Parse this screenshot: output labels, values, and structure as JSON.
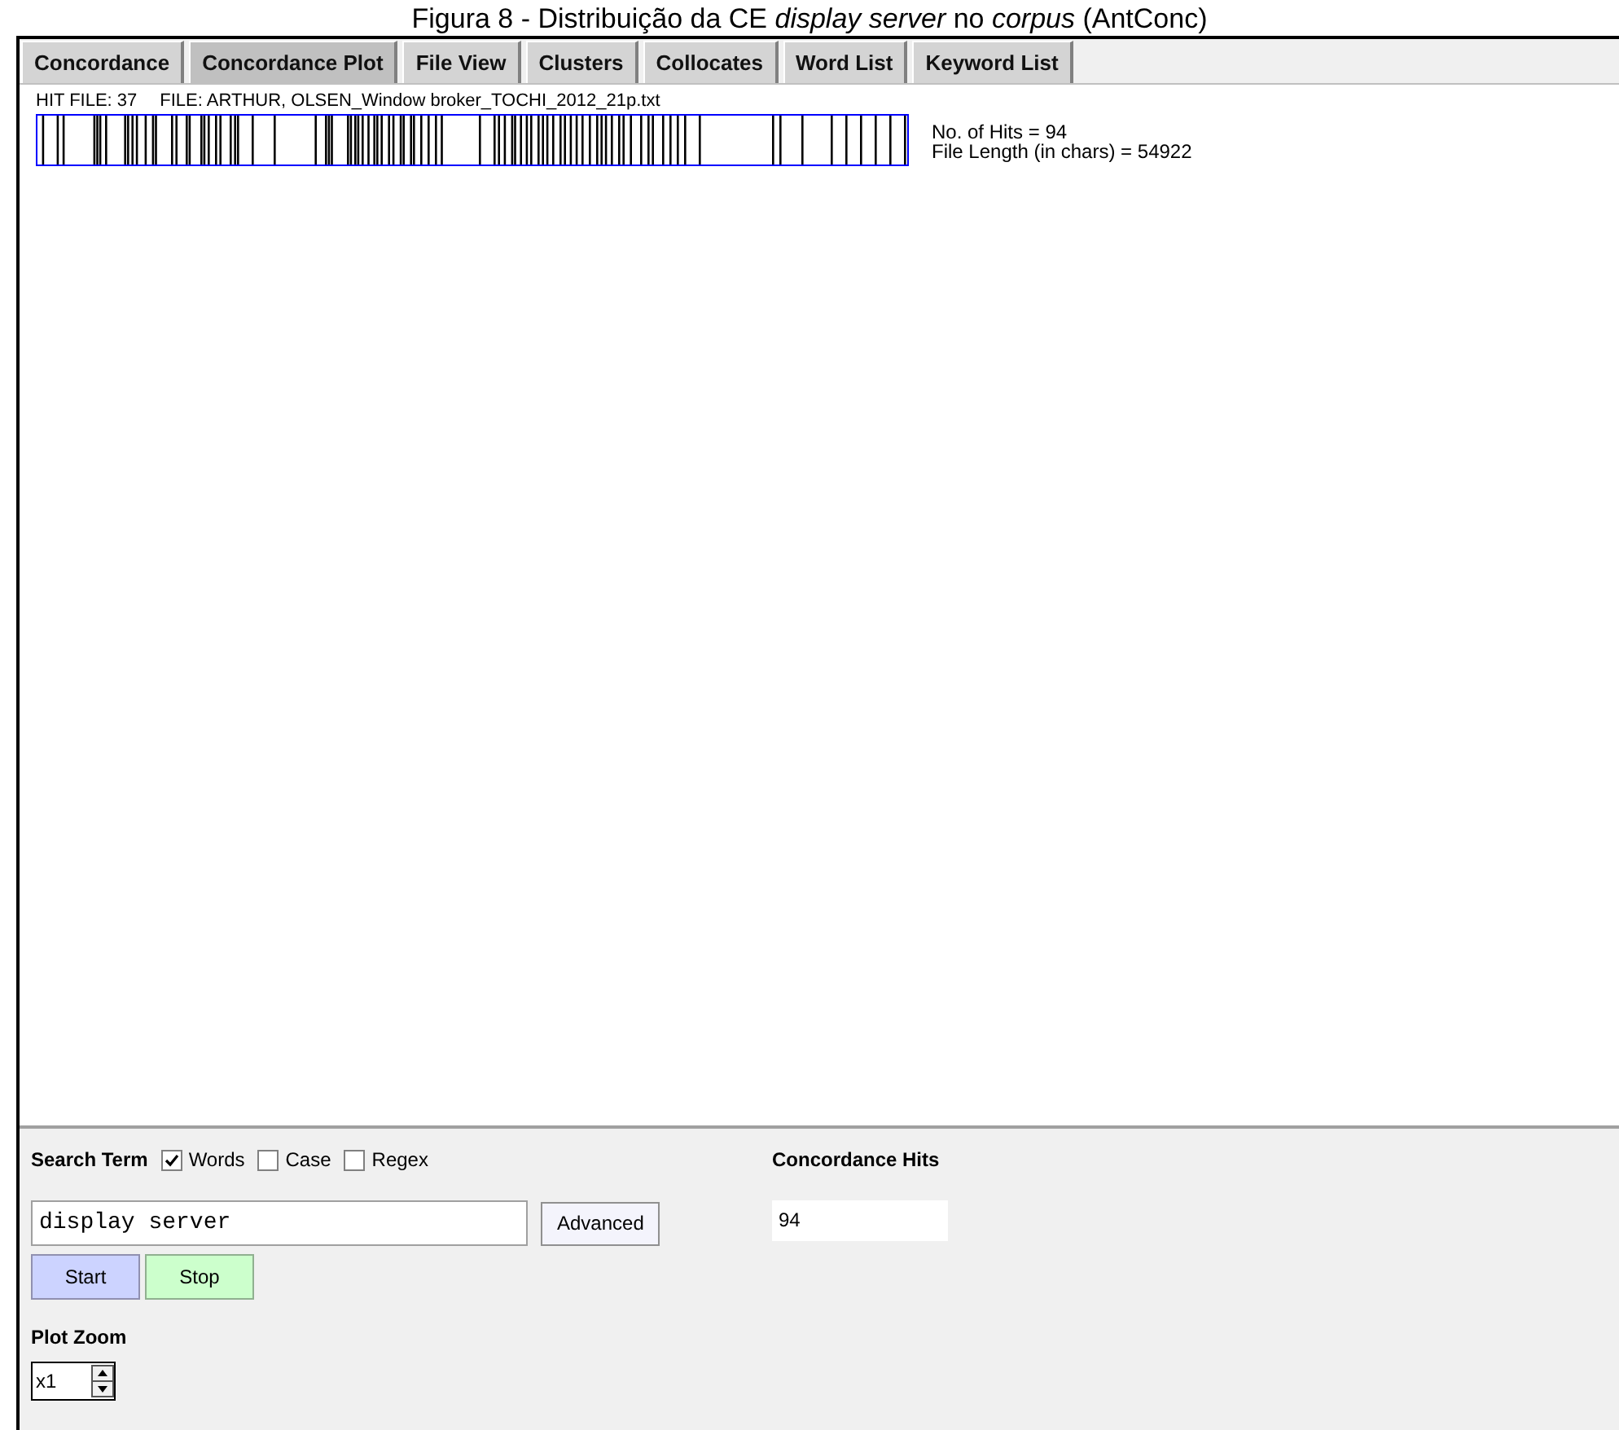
{
  "caption": "Figura 8 - Distribuição da CE *display server* no *corpus* (AntConc)",
  "tabs": [
    {
      "label": "Concordance",
      "selected": false
    },
    {
      "label": "Concordance Plot",
      "selected": true
    },
    {
      "label": "File View",
      "selected": false
    },
    {
      "label": "Clusters",
      "selected": false
    },
    {
      "label": "Collocates",
      "selected": false
    },
    {
      "label": "Word List",
      "selected": false
    },
    {
      "label": "Keyword List",
      "selected": false
    }
  ],
  "plot": {
    "hit_file": "HIT FILE: 37",
    "file": "FILE: ARTHUR, OLSEN_Window broker_TOCHI_2012_21p.txt",
    "hits": "No. of Hits = 94",
    "file_length": "File Length (in chars) = 54922"
  },
  "search": {
    "label": "Search Term",
    "options": [
      {
        "label": "Words",
        "checked": true
      },
      {
        "label": "Case",
        "checked": false
      },
      {
        "label": "Regex",
        "checked": false
      }
    ],
    "value": "display server",
    "advanced": "Advanced",
    "start": "Start",
    "stop": "Stop"
  },
  "concordance_hits": {
    "label": "Concordance Hits",
    "value": "94"
  },
  "plot_zoom": {
    "label": "Plot Zoom",
    "value": "x1"
  }
}
